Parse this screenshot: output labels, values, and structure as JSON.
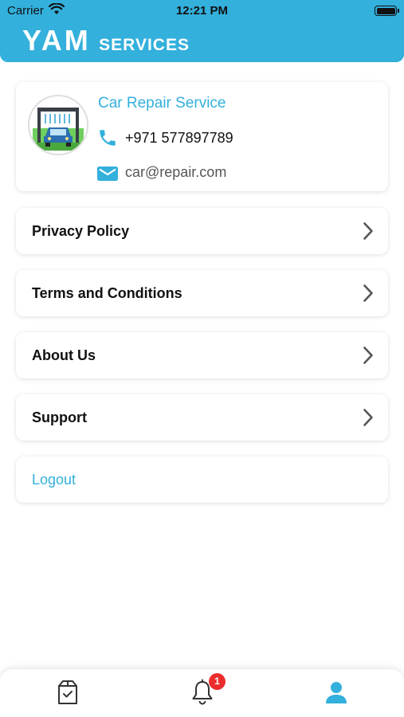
{
  "status_bar": {
    "carrier": "Carrier",
    "time": "12:21 PM"
  },
  "header": {
    "brand_main": "YAM",
    "brand_sub": "SERVICES",
    "color": "#33b0dc"
  },
  "profile": {
    "name": "Car Repair Service",
    "phone": "+971 577897789",
    "email": "car@repair.com",
    "avatar_icon": "car-wash-icon"
  },
  "menu": [
    {
      "label": "Privacy Policy",
      "icon": "chevron-right-icon"
    },
    {
      "label": "Terms and Conditions",
      "icon": "chevron-right-icon"
    },
    {
      "label": "About Us",
      "icon": "chevron-right-icon"
    },
    {
      "label": "Support",
      "icon": "chevron-right-icon"
    }
  ],
  "logout": {
    "label": "Logout"
  },
  "tab_bar": {
    "tabs": [
      {
        "icon": "orders-box-icon"
      },
      {
        "icon": "bell-icon"
      },
      {
        "icon": "user-icon",
        "active": true
      }
    ],
    "notification_count": "1",
    "active_color": "#33b0dc"
  }
}
